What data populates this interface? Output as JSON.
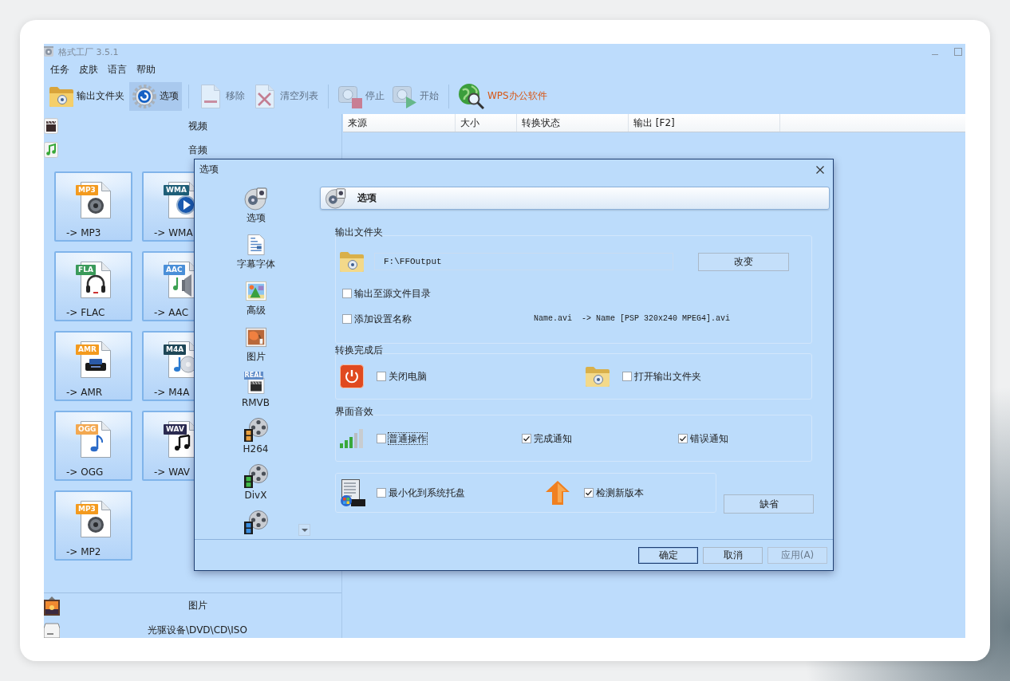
{
  "window": {
    "title": "格式工厂 3.5.1"
  },
  "menu": [
    {
      "label": "任务"
    },
    {
      "label": "皮肤"
    },
    {
      "label": "语言"
    },
    {
      "label": "帮助"
    }
  ],
  "toolbar_groups": [
    {
      "items": [
        {
          "label": "输出文件夹",
          "kind": "tool",
          "selected": false,
          "disabled": false
        },
        {
          "label": "选项",
          "kind": "tool",
          "selected": true,
          "disabled": false
        }
      ]
    },
    {
      "items": [
        {
          "label": "移除",
          "kind": "tool",
          "selected": false,
          "disabled": true
        },
        {
          "label": "清空列表",
          "kind": "tool",
          "selected": false,
          "disabled": true
        }
      ]
    },
    {
      "items": [
        {
          "label": "停止",
          "kind": "tool",
          "selected": false,
          "disabled": true
        },
        {
          "label": "开始",
          "kind": "tool",
          "selected": false,
          "disabled": true
        }
      ]
    },
    {
      "items": [
        {
          "label": "WPS办公软件",
          "kind": "link",
          "selected": false,
          "disabled": false
        }
      ]
    }
  ],
  "sidebar": {
    "categories": [
      {
        "label": "视频"
      },
      {
        "label": "音频",
        "formats": [
          {
            "label": "-> MP3",
            "badge": "MP3",
            "color": "#f39a1e"
          },
          {
            "label": "-> WMA",
            "badge": "WMA",
            "color": "#1f5f78"
          },
          {
            "label": "-> FLAC",
            "badge": "FLA",
            "color": "#3a9a5a"
          },
          {
            "label": "-> AAC",
            "badge": "AAC",
            "color": "#4a8fd8"
          },
          {
            "label": "-> AMR",
            "badge": "AMR",
            "color": "#f39a1e"
          },
          {
            "label": "-> M4A",
            "badge": "M4A",
            "color": "#1e4656"
          },
          {
            "label": "-> OGG",
            "badge": "OGG",
            "color": "#f3a850"
          },
          {
            "label": "-> WAV",
            "badge": "WAV",
            "color": "#2a2a50"
          },
          {
            "label": "-> MP2",
            "badge": "MP3",
            "color": "#f39a1e"
          }
        ]
      },
      {
        "label": "图片"
      },
      {
        "label": "光驱设备\\DVD\\CD\\ISO"
      }
    ]
  },
  "table": {
    "columns": [
      "来源",
      "大小",
      "转换状态",
      "输出 [F2]"
    ]
  },
  "dialog": {
    "title": "选项",
    "nav": [
      {
        "label": "选项"
      },
      {
        "label": "字幕字体"
      },
      {
        "label": "高级"
      },
      {
        "label": "图片"
      },
      {
        "label": "RMVB",
        "badge": "REAL"
      },
      {
        "label": "H264"
      },
      {
        "label": "DivX"
      }
    ],
    "page_title": "选项",
    "output_folder": {
      "heading": "输出文件夹",
      "path": "F:\\FFOutput",
      "change_button": "改变",
      "options": [
        {
          "label": "输出至源文件目录",
          "checked": false
        },
        {
          "label": "添加设置名称",
          "checked": false,
          "example": "Name.avi  -> Name [PSP 320x240 MPEG4].avi"
        }
      ]
    },
    "after_conversion": {
      "heading": "转换完成后",
      "options": [
        {
          "label": "关闭电脑",
          "checked": false
        },
        {
          "label": "打开输出文件夹",
          "checked": false
        }
      ]
    },
    "sounds": {
      "heading": "界面音效",
      "options": [
        {
          "label": "普通操作",
          "checked": false,
          "focused": true
        },
        {
          "label": "完成通知",
          "checked": true,
          "focused": false
        },
        {
          "label": "错误通知",
          "checked": true,
          "focused": false
        }
      ]
    },
    "general": {
      "options": [
        {
          "label": "最小化到系统托盘",
          "checked": false
        },
        {
          "label": "检测新版本",
          "checked": true
        }
      ],
      "default_button": "缺省"
    },
    "buttons": [
      {
        "label": "确定",
        "default": true,
        "disabled": false
      },
      {
        "label": "取消",
        "default": false,
        "disabled": false
      },
      {
        "label": "应用(A)",
        "default": false,
        "disabled": true
      }
    ]
  }
}
